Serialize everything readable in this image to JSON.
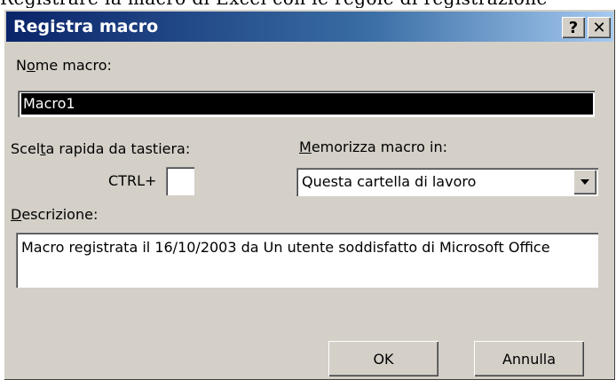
{
  "background_text": "Registrare la macro di Excel con le regole di registrazione",
  "dialog": {
    "title": "Registra macro",
    "help_symbol": "?",
    "close_symbol": "✕"
  },
  "macro_name": {
    "label_pre": "N",
    "label_mnemonic": "o",
    "label_post": "me macro:",
    "value": "Macro1"
  },
  "shortcut": {
    "label_pre": "Scel",
    "label_mnemonic": "t",
    "label_post": "a rapida da tastiera:",
    "ctrl_label": "CTRL+",
    "key_value": ""
  },
  "store_in": {
    "label_mnemonic": "M",
    "label_post": "emorizza macro in:",
    "selected": "Questa cartella di lavoro"
  },
  "description": {
    "label_mnemonic": "D",
    "label_post": "escrizione:",
    "value": "Macro registrata il 16/10/2003 da Un utente soddisfatto di Microsoft Office"
  },
  "buttons": {
    "ok": "OK",
    "cancel": "Annulla"
  },
  "colors": {
    "face": "#d4d0c8",
    "titlebar_start": "#0a246a",
    "titlebar_end": "#a6caf0"
  }
}
